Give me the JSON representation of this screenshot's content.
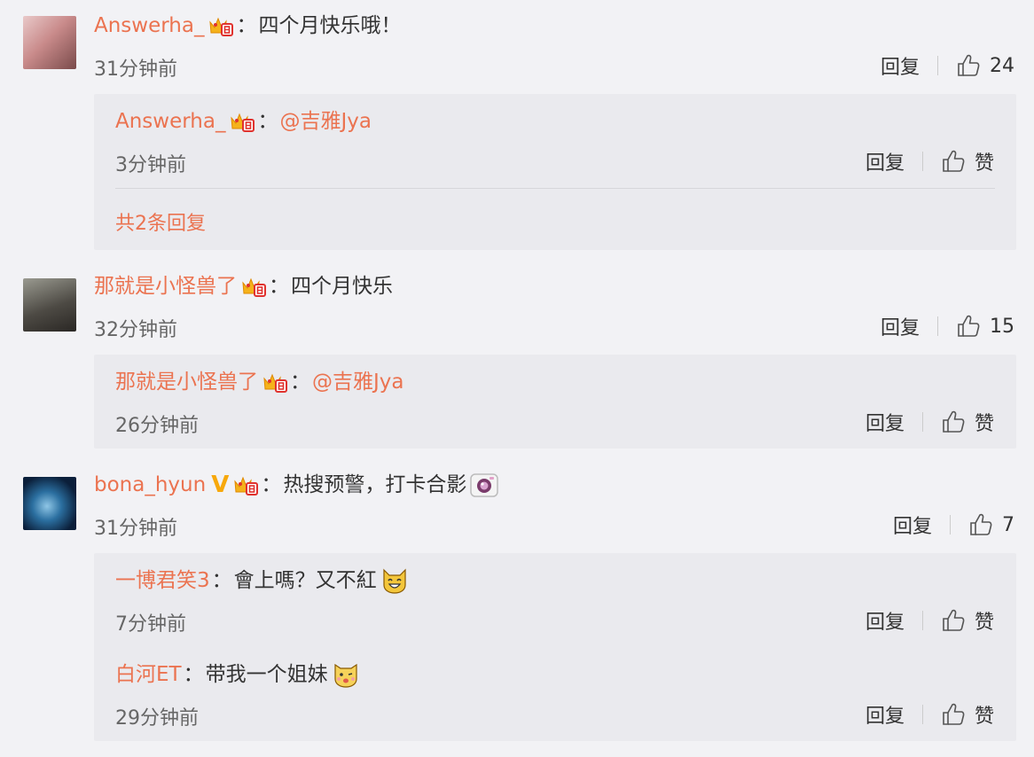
{
  "comments": [
    {
      "user": "Answerha_",
      "text": "四个月快乐哦！",
      "time": "31分钟前",
      "reply_label": "回复",
      "likes": "24",
      "replies": [
        {
          "user": "Answerha_",
          "mention": "@吉雅Jya",
          "time": "3分钟前",
          "reply_label": "回复",
          "like_label": "赞"
        }
      ],
      "more_label": "共2条回复"
    },
    {
      "user": "那就是小怪兽了",
      "text": "四个月快乐",
      "time": "32分钟前",
      "reply_label": "回复",
      "likes": "15",
      "replies": [
        {
          "user": "那就是小怪兽了",
          "mention": "@吉雅Jya",
          "time": "26分钟前",
          "reply_label": "回复",
          "like_label": "赞"
        }
      ]
    },
    {
      "user": "bona_hyun",
      "verified_mark": "V",
      "text": "热搜预警，打卡合影",
      "time": "31分钟前",
      "reply_label": "回复",
      "likes": "7",
      "replies": [
        {
          "user": "一博君笑3",
          "text": "會上嗎？又不紅",
          "time": "7分钟前",
          "reply_label": "回复",
          "like_label": "赞"
        },
        {
          "user": "白河ET",
          "text": "带我一个姐妹",
          "time": "29分钟前",
          "reply_label": "回复",
          "like_label": "赞"
        }
      ]
    }
  ],
  "colors": {
    "username": "#eb7350",
    "background": "#f2f2f5",
    "sub_background": "#eaeaee"
  },
  "icons": {
    "crown": "crown-badge-icon",
    "thumb": "thumbs-up-icon",
    "camera": "camera-emoji-icon",
    "cat": "laughing-cat-emoji-icon",
    "dog": "dog-emoji-icon"
  }
}
